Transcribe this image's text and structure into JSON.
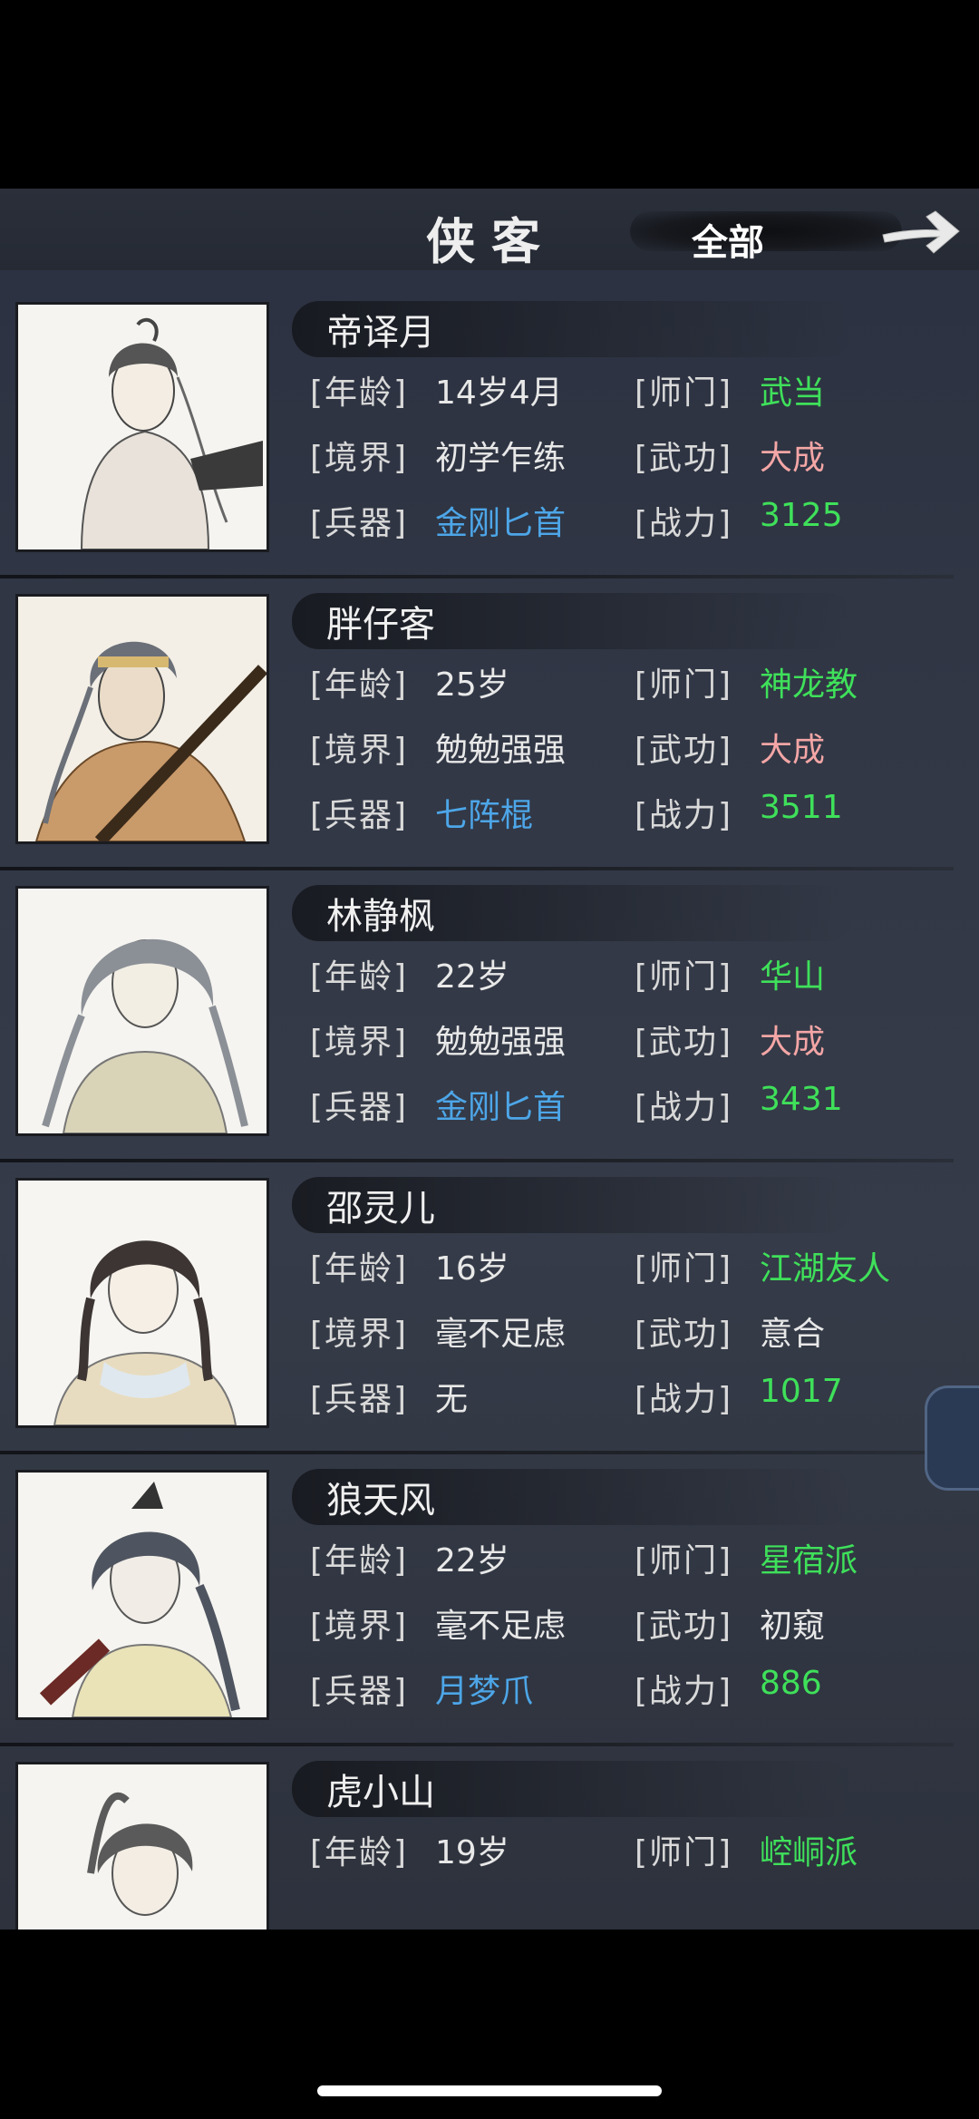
{
  "header": {
    "title": "侠客",
    "filter_label": "全部"
  },
  "labels": {
    "age": "[年龄]",
    "realm": "[境界]",
    "weapon": "[兵器]",
    "sect": "[师门]",
    "martial": "[武功]",
    "power": "[战力]"
  },
  "characters": [
    {
      "name": "帝译月",
      "age": "14岁4月",
      "realm": "初学乍练",
      "weapon": "金刚匕首",
      "sect": "武当",
      "martial": "大成",
      "power": "3125"
    },
    {
      "name": "胖仔客",
      "age": "25岁",
      "realm": "勉勉强强",
      "weapon": "七阵棍",
      "sect": "神龙教",
      "martial": "大成",
      "power": "3511"
    },
    {
      "name": "林静枫",
      "age": "22岁",
      "realm": "勉勉强强",
      "weapon": "金刚匕首",
      "sect": "华山",
      "martial": "大成",
      "power": "3431"
    },
    {
      "name": "邵灵儿",
      "age": "16岁",
      "realm": "毫不足虑",
      "weapon": "无",
      "sect": "江湖友人",
      "martial": "意合",
      "power": "1017"
    },
    {
      "name": "狼天风",
      "age": "22岁",
      "realm": "毫不足虑",
      "weapon": "月梦爪",
      "sect": "星宿派",
      "martial": "初窥",
      "power": "886"
    },
    {
      "name": "虎小山",
      "age": "19岁",
      "realm": "",
      "weapon": "",
      "sect": "崆峒派",
      "martial": "",
      "power": ""
    }
  ],
  "colors": {
    "green": "#3fe05a",
    "pink": "#f4a6a6",
    "blue": "#4da6e8",
    "background": "#313745"
  }
}
